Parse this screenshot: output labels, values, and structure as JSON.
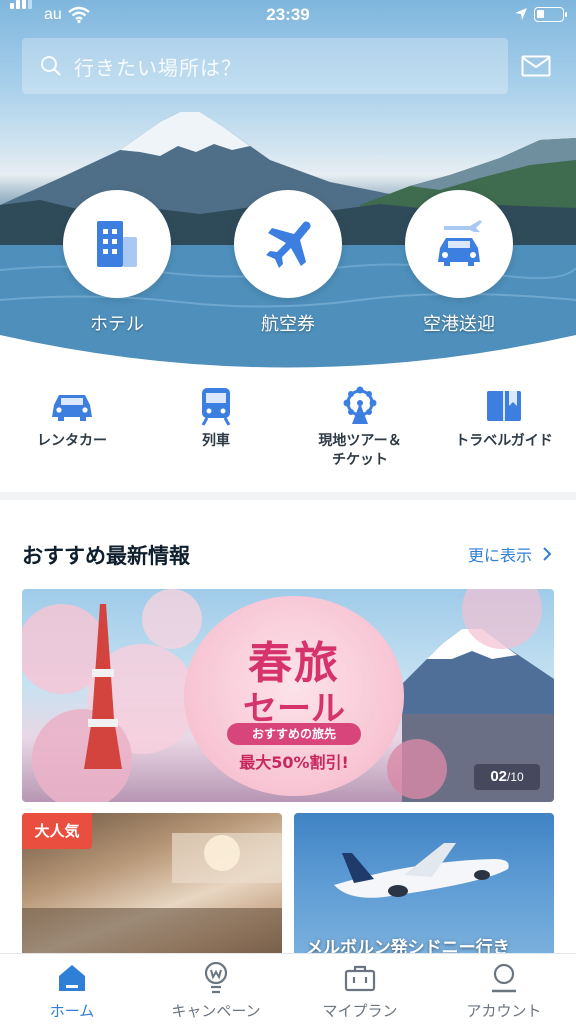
{
  "status_bar": {
    "carrier": "au",
    "time": "23:39"
  },
  "search": {
    "placeholder": "行きたい場所は？"
  },
  "hero_categories": [
    {
      "label": "ホテル",
      "icon": "hotel-icon"
    },
    {
      "label": "航空券",
      "icon": "airplane-icon"
    },
    {
      "label": "空港送迎",
      "icon": "airport-transfer-icon"
    }
  ],
  "quick_categories": [
    {
      "label": "レンタカー",
      "icon": "car-icon"
    },
    {
      "label": "列車",
      "icon": "train-icon"
    },
    {
      "label": "現地ツアー＆\nチケット",
      "icon": "ferris-wheel-icon"
    },
    {
      "label": "トラベルガイド",
      "icon": "book-icon"
    }
  ],
  "recommend": {
    "title": "おすすめ最新情報",
    "more_label": "更に表示",
    "banner": {
      "title_line1": "春旅",
      "title_line2": "セール",
      "pill": "おすすめの旅先",
      "discount": "最大50%割引!",
      "counter_current": "02",
      "counter_total": "/10"
    },
    "cards": [
      {
        "badge": "大人気",
        "caption": ""
      },
      {
        "badge": "",
        "caption": "メルボルン発シドニー行き"
      }
    ]
  },
  "tabs": [
    {
      "label": "ホーム",
      "icon": "home-icon",
      "active": true
    },
    {
      "label": "キャンペーン",
      "icon": "lightbulb-icon",
      "active": false
    },
    {
      "label": "マイプラン",
      "icon": "briefcase-icon",
      "active": false
    },
    {
      "label": "アカウント",
      "icon": "user-icon",
      "active": false
    }
  ],
  "colors": {
    "accent": "#2f7fd6",
    "icon_blue": "#3d7fe0",
    "badge_red": "#e94e3f",
    "sale_pink": "#d6336c"
  }
}
